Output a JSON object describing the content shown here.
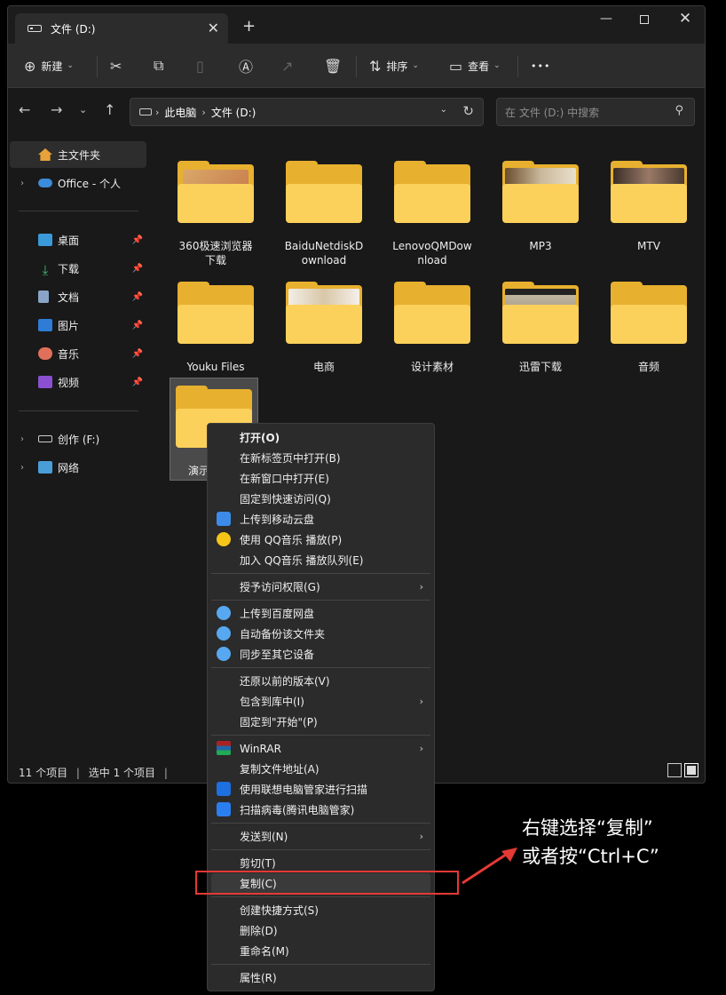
{
  "window": {
    "tab_title": "文件 (D:)",
    "tab_close": "✕",
    "tab_add": "+",
    "min": "—",
    "close": "✕"
  },
  "toolbar": {
    "new_label": "新建",
    "sort_label": "排序",
    "view_label": "查看",
    "more": "•••"
  },
  "address": {
    "crumbs": [
      "此电脑",
      "文件 (D:)"
    ],
    "search_placeholder": "在 文件 (D:) 中搜索"
  },
  "sidebar": {
    "home": "主文件夹",
    "office": "Office - 个人",
    "desktop": "桌面",
    "downloads": "下载",
    "documents": "文档",
    "pictures": "图片",
    "music": "音乐",
    "videos": "视频",
    "drive_f": "创作 (F:)",
    "network": "网络"
  },
  "folders": [
    {
      "name": "360极速浏览器\n下载"
    },
    {
      "name": "BaiduNetdiskD\nownload"
    },
    {
      "name": "LenovoQMDow\nnload"
    },
    {
      "name": "MP3"
    },
    {
      "name": "MTV"
    },
    {
      "name": "Youku Files"
    },
    {
      "name": "电商"
    },
    {
      "name": "设计素材"
    },
    {
      "name": "迅雷下载"
    },
    {
      "name": "音频"
    },
    {
      "name": "演示文"
    }
  ],
  "status": {
    "count": "11 个项目",
    "selected": "选中 1 个项目"
  },
  "context_menu": {
    "items": [
      "打开(O)",
      "在新标签页中打开(B)",
      "在新窗口中打开(E)",
      "固定到快速访问(Q)",
      "上传到移动云盘",
      "使用 QQ音乐 播放(P)",
      "加入 QQ音乐 播放队列(E)",
      "授予访问权限(G)",
      "上传到百度网盘",
      "自动备份该文件夹",
      "同步至其它设备",
      "还原以前的版本(V)",
      "包含到库中(I)",
      "固定到\"开始\"(P)",
      "WinRAR",
      "复制文件地址(A)",
      "使用联想电脑管家进行扫描",
      "扫描病毒(腾讯电脑管家)",
      "发送到(N)",
      "剪切(T)",
      "复制(C)",
      "创建快捷方式(S)",
      "删除(D)",
      "重命名(M)",
      "属性(R)"
    ]
  },
  "annotation": {
    "text": "右键选择“复制”\n或者按“Ctrl+C”"
  },
  "colors": {
    "highlight_box": "#e53935",
    "folder": "#fcd15b"
  }
}
